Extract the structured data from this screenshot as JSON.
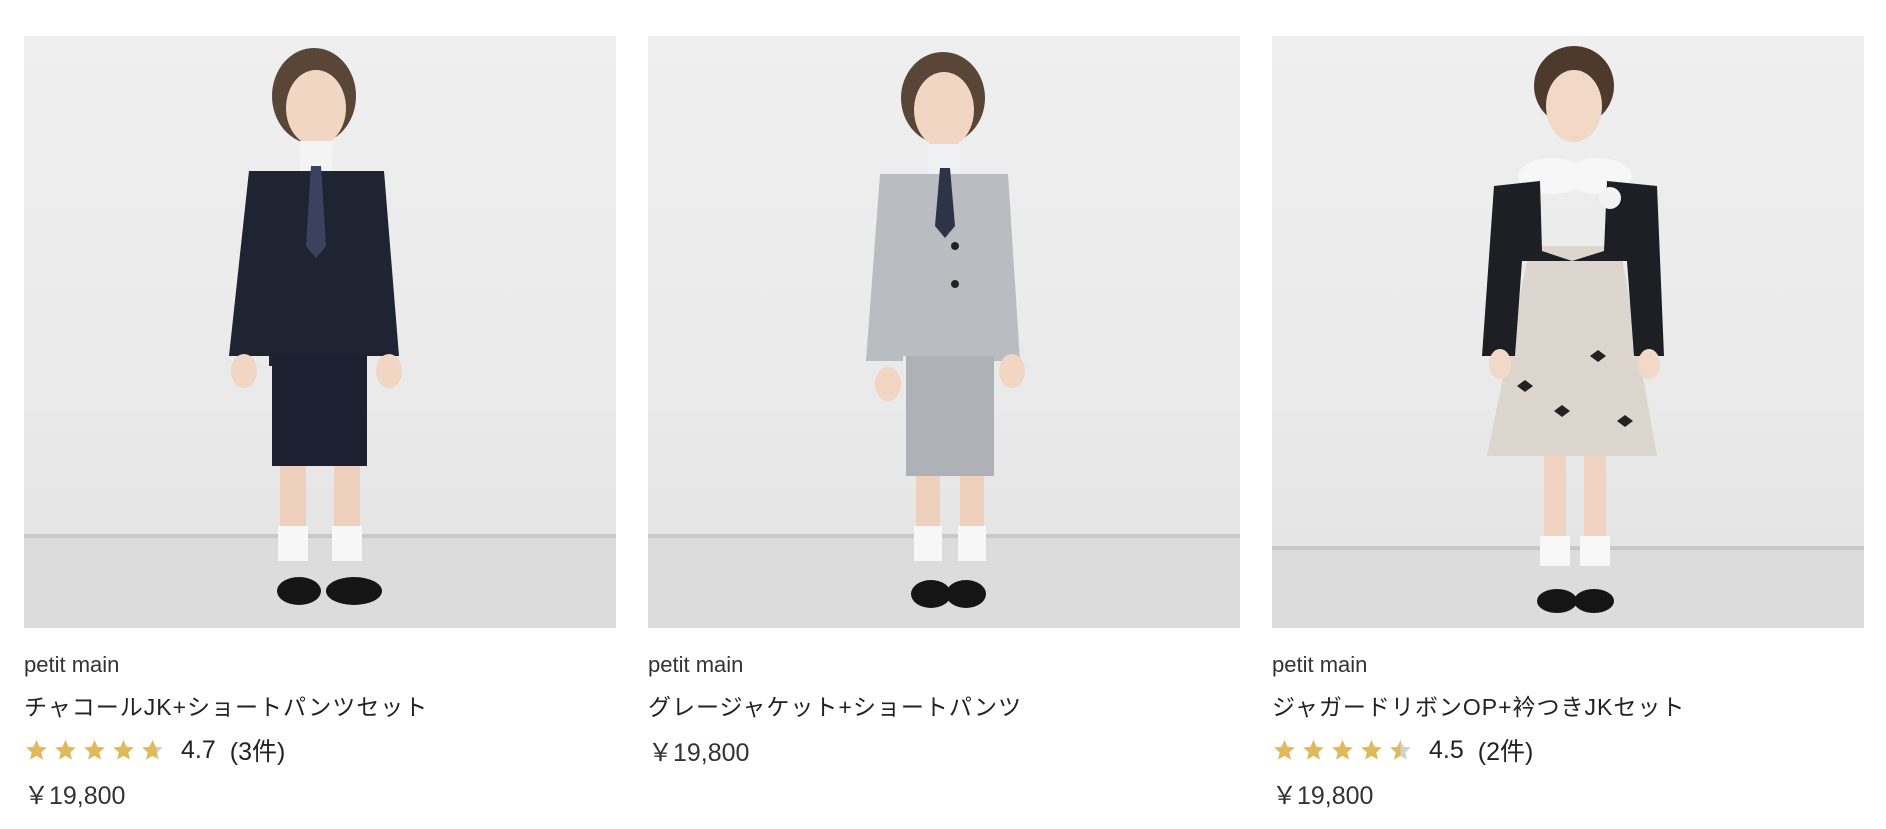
{
  "products": [
    {
      "brand": "petit main",
      "name": "チャコールJK+ショートパンツセット",
      "rating": "4.7",
      "rating_fraction": 0.94,
      "reviews": "(3件)",
      "price": "￥19,800",
      "image_alt": "boy in charcoal jacket and short pants",
      "colors": {
        "jacket": "#1f2433",
        "pants": "#1c2030",
        "tie": "#3a4260"
      }
    },
    {
      "brand": "petit main",
      "name": "グレージャケット+ショートパンツ",
      "price": "￥19,800",
      "image_alt": "boy in grey jacket and short pants",
      "colors": {
        "jacket": "#b9bcc1",
        "pants": "#aeb1b6",
        "tie": "#2d3447"
      }
    },
    {
      "brand": "petit main",
      "name": "ジャガードリボンOP+衿つきJKセット",
      "rating": "4.5",
      "rating_fraction": 0.9,
      "reviews": "(2件)",
      "price": "￥19,800",
      "image_alt": "girl in black bolero jacket and jacquard ribbon dress",
      "colors": {
        "jacket": "#1d1f24",
        "dress": "#ddd6cf",
        "tie": "#222222"
      }
    }
  ],
  "star_color": "#e0b95a",
  "star_empty_color": "#d0d0d0"
}
